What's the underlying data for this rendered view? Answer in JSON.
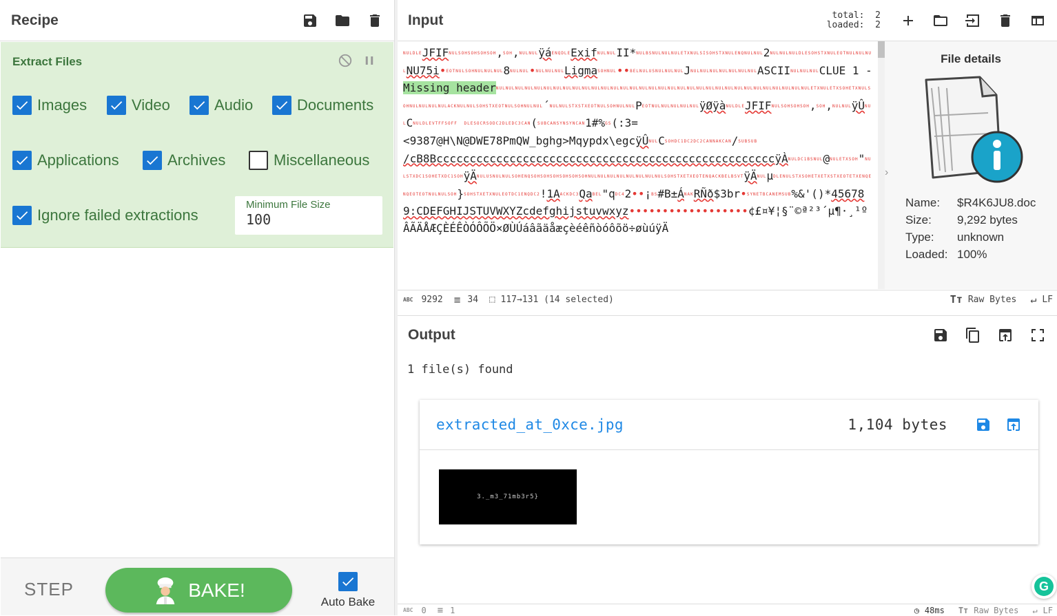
{
  "recipe": {
    "title": "Recipe",
    "operation": {
      "title": "Extract Files",
      "checkboxes": [
        {
          "label": "Images",
          "checked": true
        },
        {
          "label": "Video",
          "checked": true
        },
        {
          "label": "Audio",
          "checked": true
        },
        {
          "label": "Documents",
          "checked": true
        },
        {
          "label": "Applications",
          "checked": true
        },
        {
          "label": "Archives",
          "checked": true
        },
        {
          "label": "Miscellaneous",
          "checked": false
        },
        {
          "label": "Ignore failed extractions",
          "checked": true
        }
      ],
      "min_file_size_label": "Minimum File Size",
      "min_file_size_value": "100"
    },
    "step_label": "STEP",
    "bake_label": "BAKE!",
    "auto_bake_label": "Auto Bake",
    "auto_bake_checked": true
  },
  "input": {
    "title": "Input",
    "stats_total_label": "total:",
    "stats_total_value": "2",
    "stats_loaded_label": "loaded:",
    "stats_loaded_value": "2",
    "file_details": {
      "title": "File details",
      "name_label": "Name:",
      "name_value": "$R4K6JU8.doc",
      "size_label": "Size:",
      "size_value": "9,292 bytes",
      "type_label": "Type:",
      "type_value": "unknown",
      "loaded_label": "Loaded:",
      "loaded_value": "100%"
    },
    "status": {
      "length": "9292",
      "lines": "34",
      "selection": "117→131 (14 selected)",
      "format": "Raw Bytes",
      "eol": "LF"
    }
  },
  "output": {
    "title": "Output",
    "found_text": "1 file(s) found",
    "file_name": "extracted_at_0xce.jpg",
    "file_size": "1,104 bytes",
    "thumb_text": "3._m3_71mb3r5}",
    "status": {
      "length": "0",
      "lines": "1",
      "time": "48ms",
      "format": "Raw Bytes",
      "eol": "LF"
    }
  },
  "colors": {
    "accent_green": "#5cb85c",
    "op_bg": "#dff0d8",
    "op_text": "#3c763d",
    "checkbox_blue": "#1976d2",
    "link_blue": "#1e88e5",
    "control_char_red": "#e53935"
  },
  "icons": [
    "save-icon",
    "folder-icon",
    "trash-icon",
    "disable-icon",
    "pause-icon",
    "plus-icon",
    "open-folder-icon",
    "input-swap-icon",
    "layout-icon",
    "copy-icon",
    "replace-input-icon",
    "maximise-icon",
    "chef-icon",
    "file-info-icon",
    "timer-icon",
    "text-format-icon",
    "return-icon"
  ]
}
